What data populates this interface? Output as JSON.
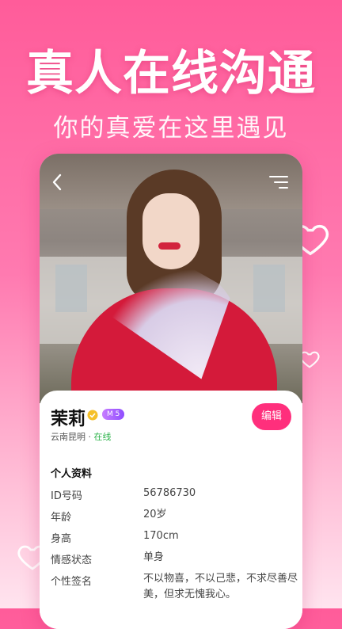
{
  "headline": "真人在线沟通",
  "subline": "你的真爱在这里遇见",
  "profile": {
    "name": "茉莉",
    "level_badge": "M 5",
    "location": "云南昆明",
    "separator": " · ",
    "status": "在线",
    "edit_label": "编辑"
  },
  "info": {
    "title": "个人资料",
    "rows": [
      {
        "label": "ID号码",
        "value": "56786730"
      },
      {
        "label": "年龄",
        "value": "20岁"
      },
      {
        "label": "身高",
        "value": "170cm"
      },
      {
        "label": "情感状态",
        "value": "单身"
      },
      {
        "label": "个性签名",
        "value": "不以物喜，不以己悲，不求尽善尽美，但求无愧我心。"
      }
    ]
  },
  "icons": {
    "back": "chevron-left-icon",
    "menu": "menu-icon",
    "verified": "verified-badge-icon",
    "heart": "heart-outline-icon"
  },
  "colors": {
    "accent": "#ff2f7c",
    "online": "#2cb34a",
    "level_badge": "#a865ff"
  }
}
